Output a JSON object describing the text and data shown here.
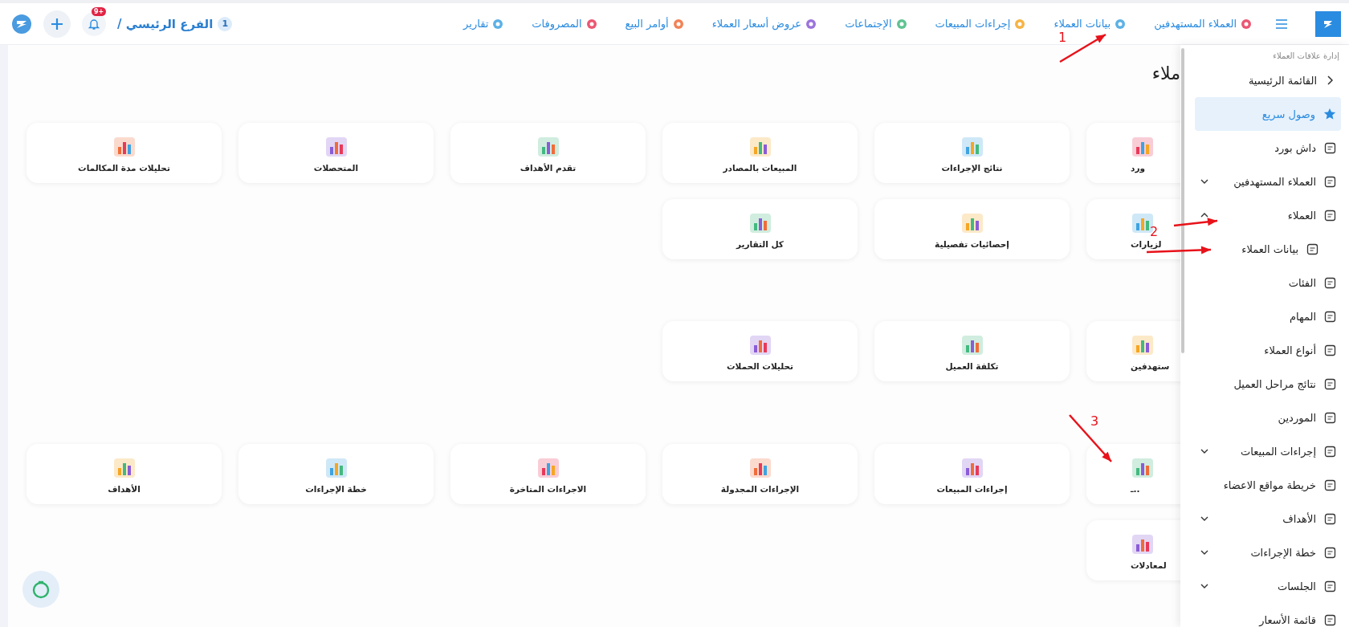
{
  "topbar": {
    "nav": [
      {
        "label": "العملاء المستهدفين"
      },
      {
        "label": "بيانات العملاء"
      },
      {
        "label": "إجراءات المبيعات"
      },
      {
        "label": "الإجتماعات"
      },
      {
        "label": "عروض أسعار العملاء"
      },
      {
        "label": "أوامر البيع"
      },
      {
        "label": "المصروفات"
      },
      {
        "label": "تقارير"
      }
    ],
    "branch_count": "1",
    "branch": "الفرع الرئيسي /",
    "notification_badge": "+9"
  },
  "page_title": "ملاء",
  "card_rows": [
    {
      "cards": [
        {
          "label": "ورد",
          "partial": true
        },
        {
          "label": "نتائج الإجراءات",
          "partial": false
        },
        {
          "label": "المبيعات بالمصادر",
          "partial": false
        },
        {
          "label": "تقدم الأهداف",
          "partial": false
        },
        {
          "label": "المتحصلات",
          "partial": false
        },
        {
          "label": "تحليلات مدة المكالمات",
          "partial": false
        }
      ]
    },
    {
      "cards": [
        {
          "label": "لزيارات",
          "partial": true
        },
        {
          "label": "إحصائيات تفصيلية",
          "partial": false
        },
        {
          "label": "كل التقارير",
          "partial": false
        }
      ]
    },
    {
      "cards": [
        {
          "label": "ستهدفين",
          "partial": true
        },
        {
          "label": "تكلفة العميل",
          "partial": false
        },
        {
          "label": "تحليلات الحملات",
          "partial": false
        }
      ]
    },
    {
      "cards": [
        {
          "label": "..ـ",
          "partial": true
        },
        {
          "label": "إجراءات المبيعات",
          "partial": false
        },
        {
          "label": "الإجراءات المجدولة",
          "partial": false
        },
        {
          "label": "الاجراءات المتاخرة",
          "partial": false
        },
        {
          "label": "خطة الإجراءات",
          "partial": false
        },
        {
          "label": "الأهداف",
          "partial": false
        }
      ]
    },
    {
      "cards": [
        {
          "label": "لمعادلات",
          "partial": true
        }
      ]
    }
  ],
  "sidebar": {
    "heading": "إدارة علاقات العملاء",
    "items": [
      {
        "label": "القائمة الرئيسية",
        "kind": "back",
        "selected": false
      },
      {
        "label": "وصول سريع",
        "kind": "link",
        "selected": true
      },
      {
        "label": "داش بورد",
        "kind": "link",
        "selected": false
      },
      {
        "label": "العملاء المستهدفين",
        "kind": "group",
        "selected": false,
        "expanded": false
      },
      {
        "label": "العملاء",
        "kind": "group",
        "selected": false,
        "expanded": true,
        "children": [
          {
            "label": "بيانات العملاء",
            "selected": false
          }
        ]
      },
      {
        "label": "الفئات",
        "kind": "link",
        "selected": false
      },
      {
        "label": "المهام",
        "kind": "link",
        "selected": false
      },
      {
        "label": "أنواع العملاء",
        "kind": "link",
        "selected": false
      },
      {
        "label": "نتائج مراحل العميل",
        "kind": "link",
        "selected": false
      },
      {
        "label": "الموردين",
        "kind": "link",
        "selected": false
      },
      {
        "label": "إجراءات المبيعات",
        "kind": "group",
        "selected": false,
        "expanded": false
      },
      {
        "label": "خريطة مواقع الاعضاء",
        "kind": "link",
        "selected": false
      },
      {
        "label": "الأهداف",
        "kind": "group",
        "selected": false,
        "expanded": false
      },
      {
        "label": "خطة الإجراءات",
        "kind": "group",
        "selected": false,
        "expanded": false
      },
      {
        "label": "الجلسات",
        "kind": "group",
        "selected": false,
        "expanded": false
      },
      {
        "label": "قائمة الأسعار",
        "kind": "link",
        "selected": false
      }
    ]
  },
  "annotations": [
    {
      "label": "1"
    },
    {
      "label": "2"
    },
    {
      "label": "3"
    }
  ]
}
